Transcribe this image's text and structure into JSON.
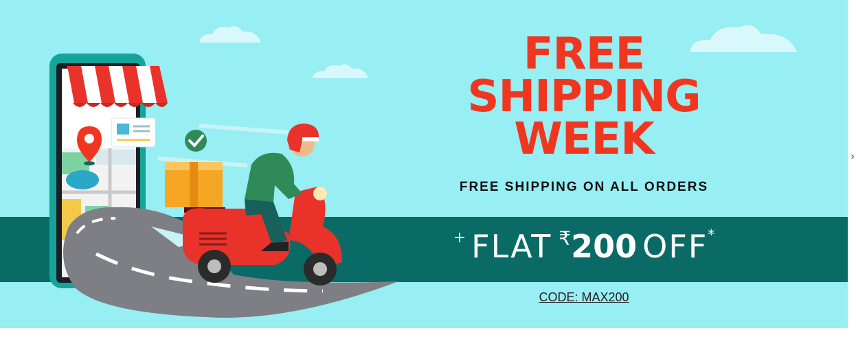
{
  "banner": {
    "headline_lines": [
      "FREE",
      "SHIPPING",
      "WEEK"
    ],
    "subline": "FREE SHIPPING ON ALL ORDERS",
    "offer": {
      "plus": "+",
      "flat": "FLAT",
      "currency": "₹",
      "amount": "200",
      "off": "OFF",
      "asterisk": "*"
    },
    "code": "CODE: MAX200",
    "next_icon": "›"
  },
  "colors": {
    "sky": "#97eef3",
    "band": "#0a6b66",
    "headline": "#f1361f",
    "scooter": "#e8322a",
    "helmet": "#e8322a",
    "shirt": "#2e8b57"
  },
  "icons": [
    "cloud-icon",
    "location-pin-icon",
    "checkmark-icon",
    "shop-awning-icon",
    "chevron-right-icon"
  ]
}
